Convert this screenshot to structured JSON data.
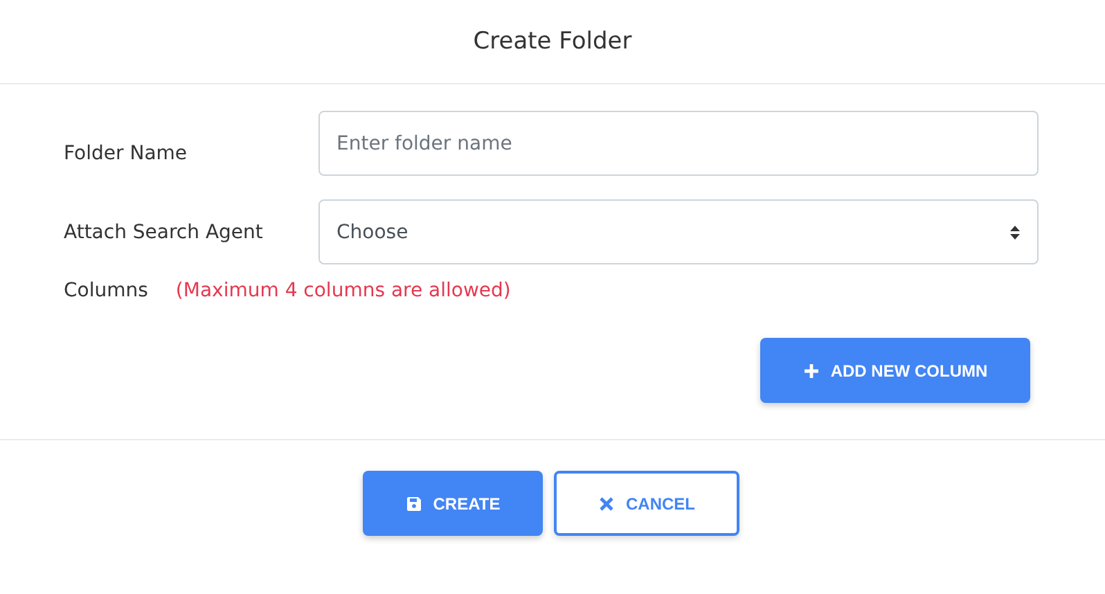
{
  "window": {
    "title": "Create Folder"
  },
  "fields": [
    {
      "label": "Folder Name",
      "kind": "text",
      "placeholder": "Enter folder name"
    },
    {
      "label": "Attach Search Agent",
      "kind": "select",
      "value": "Choose"
    }
  ],
  "columns": {
    "label": "Columns",
    "note": "(Maximum 4 columns are allowed)"
  },
  "add_button": {
    "label": "ADD NEW COLUMN"
  },
  "buttons": [
    {
      "label": "CREATE",
      "kind": "primary"
    },
    {
      "label": "CANCEL",
      "kind": "outline"
    }
  ]
}
